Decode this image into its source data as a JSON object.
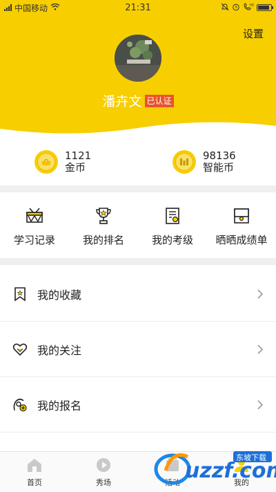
{
  "status_bar": {
    "carrier": "中国移动",
    "time": "21:31",
    "battery_level": 0.9
  },
  "header": {
    "settings_label": "设置",
    "user_name": "潘卉文",
    "verified_badge": "已认证",
    "background_color": "#f7ce00"
  },
  "wallet": {
    "items": [
      {
        "value": "1121",
        "label": "金币",
        "icon": "gold-coin-icon"
      },
      {
        "value": "98136",
        "label": "智能币",
        "icon": "smart-coin-icon"
      }
    ]
  },
  "shortcuts": {
    "items": [
      {
        "label": "学习记录",
        "icon": "drum-icon"
      },
      {
        "label": "我的排名",
        "icon": "trophy-icon"
      },
      {
        "label": "我的考级",
        "icon": "certificate-icon"
      },
      {
        "label": "晒晒成绩单",
        "icon": "report-card-icon"
      }
    ]
  },
  "menu": {
    "items": [
      {
        "label": "我的收藏",
        "icon": "bookmark-star-icon"
      },
      {
        "label": "我的关注",
        "icon": "heart-icon"
      },
      {
        "label": "我的报名",
        "icon": "registration-icon"
      }
    ]
  },
  "tabbar": {
    "items": [
      {
        "label": "首页",
        "icon": "home-icon"
      },
      {
        "label": "秀场",
        "icon": "play-icon"
      },
      {
        "label": "活动",
        "icon": "activity-icon"
      },
      {
        "label": "我的",
        "icon": "profile-icon",
        "active": true
      }
    ]
  },
  "watermark": {
    "brand": "uzzf.com",
    "tagline": "东坡下载"
  }
}
